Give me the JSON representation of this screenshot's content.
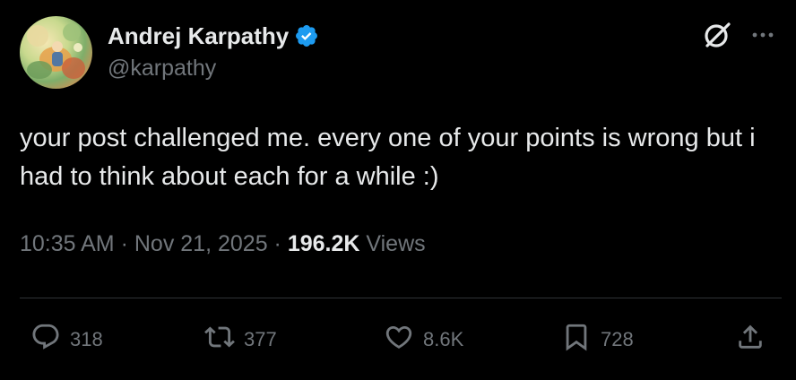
{
  "author": {
    "display_name": "Andrej Karpathy",
    "handle": "@karpathy",
    "verified": true
  },
  "tweet": {
    "text": "your post challenged me. every one of your points is wrong but i had to think about each for a while :)",
    "time": "10:35 AM",
    "separator": "·",
    "date": "Nov 21, 2025",
    "views_count": "196.2K",
    "views_label": "Views"
  },
  "actions": {
    "replies": "318",
    "reposts": "377",
    "likes": "8.6K",
    "bookmarks": "728"
  },
  "icons": {
    "verified": "verified-badge-icon",
    "grok": "grok-icon",
    "more": "more-icon",
    "reply": "reply-icon",
    "repost": "repost-icon",
    "like": "heart-icon",
    "bookmark": "bookmark-icon",
    "share": "share-icon"
  },
  "colors": {
    "background": "#000000",
    "text_primary": "#e7e9ea",
    "text_secondary": "#71767b",
    "verified_blue": "#1d9bf0",
    "divider": "#2f3336"
  }
}
